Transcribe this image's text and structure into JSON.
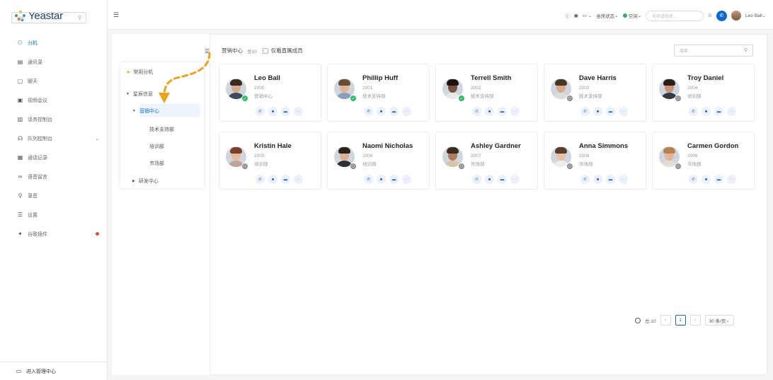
{
  "app": {
    "logo_text": "Yeastar"
  },
  "sidebar": {
    "items": [
      {
        "label": "分机",
        "icon": "extension-icon",
        "active": true
      },
      {
        "label": "通讯录",
        "icon": "contacts-icon"
      },
      {
        "label": "聊天",
        "icon": "chat-icon"
      },
      {
        "label": "视频会议",
        "icon": "video-conference-icon"
      },
      {
        "label": "话务控制台",
        "icon": "operator-panel-icon"
      },
      {
        "label": "队列控制台",
        "icon": "queue-panel-icon",
        "has_caret": true
      },
      {
        "label": "通话记录",
        "icon": "call-log-icon"
      },
      {
        "label": "语音留言",
        "icon": "voicemail-icon"
      },
      {
        "label": "录音",
        "icon": "recording-icon"
      },
      {
        "label": "设置",
        "icon": "settings-icon"
      },
      {
        "label": "谷歌插件",
        "icon": "plugin-icon",
        "has_dot": true
      }
    ],
    "admin_label": "进入管理中心"
  },
  "topbar": {
    "agent_status": "坐席状态",
    "presence": "空闲",
    "search_placeholder": "号码或姓名...",
    "user_name": "Leo Ball"
  },
  "tree": {
    "search_placeholder": "搜索",
    "favorites": "常用分机",
    "root": "星辰信息",
    "children": [
      "营销中心",
      "技术支持部",
      "培训部",
      "市场部",
      "研发中心"
    ]
  },
  "group": {
    "name": "营销中心",
    "count": "总10",
    "direct_only": "仅看直属成员",
    "search_placeholder": "搜索"
  },
  "contacts": [
    {
      "name": "Leo Ball",
      "ext": "2000",
      "dept": "营销中心",
      "status": "online",
      "skin": "#d8a98a",
      "hair": "#3a2a22",
      "shirt": "#3d4a5c"
    },
    {
      "name": "Phillip Huff",
      "ext": "2001",
      "dept": "技术支持部",
      "status": "online",
      "skin": "#e0b596",
      "hair": "#6b4b33",
      "shirt": "#8aa0b8"
    },
    {
      "name": "Terrell Smith",
      "ext": "2002",
      "dept": "技术支持部",
      "status": "online",
      "skin": "#7a5040",
      "hair": "#1d1410",
      "shirt": "#ece8e4"
    },
    {
      "name": "Dave Harris",
      "ext": "2003",
      "dept": "技术支持部",
      "status": "offline",
      "skin": "#d9a888",
      "hair": "#4a3426",
      "shirt": "#dcdcdc"
    },
    {
      "name": "Troy Daniel",
      "ext": "2004",
      "dept": "培训部",
      "status": "offline",
      "skin": "#c89272",
      "hair": "#2a1c16",
      "shirt": "#333a44"
    },
    {
      "name": "Kristin Hale",
      "ext": "2005",
      "dept": "培训部",
      "status": "offline",
      "skin": "#e6b89c",
      "hair": "#7a3f28",
      "shirt": "#bfa29a"
    },
    {
      "name": "Naomi Nicholas",
      "ext": "2006",
      "dept": "培训部",
      "status": "offline",
      "skin": "#dcae92",
      "hair": "#2e211c",
      "shirt": "#2e2e34"
    },
    {
      "name": "Ashley Gardner",
      "ext": "2007",
      "dept": "市场部",
      "status": "offline",
      "skin": "#b07c5e",
      "hair": "#3a2a20",
      "shirt": "#d9c4aa"
    },
    {
      "name": "Anna Simmons",
      "ext": "2008",
      "dept": "市场部",
      "status": "offline",
      "skin": "#e7c0a6",
      "hair": "#5a3a28",
      "shirt": "#f0ede9"
    },
    {
      "name": "Carmen Gordon",
      "ext": "2009",
      "dept": "市场部",
      "status": "offline",
      "skin": "#e4b494",
      "hair": "#b8824e",
      "shirt": "#e6ddd3"
    }
  ],
  "pagination": {
    "total": "总:10",
    "current_page": "1",
    "page_size": "30 条/页"
  },
  "colors": {
    "accent": "#0c71d9",
    "online": "#33b96a",
    "offline": "#8c8c8c",
    "annotation": "#f0a21a"
  }
}
